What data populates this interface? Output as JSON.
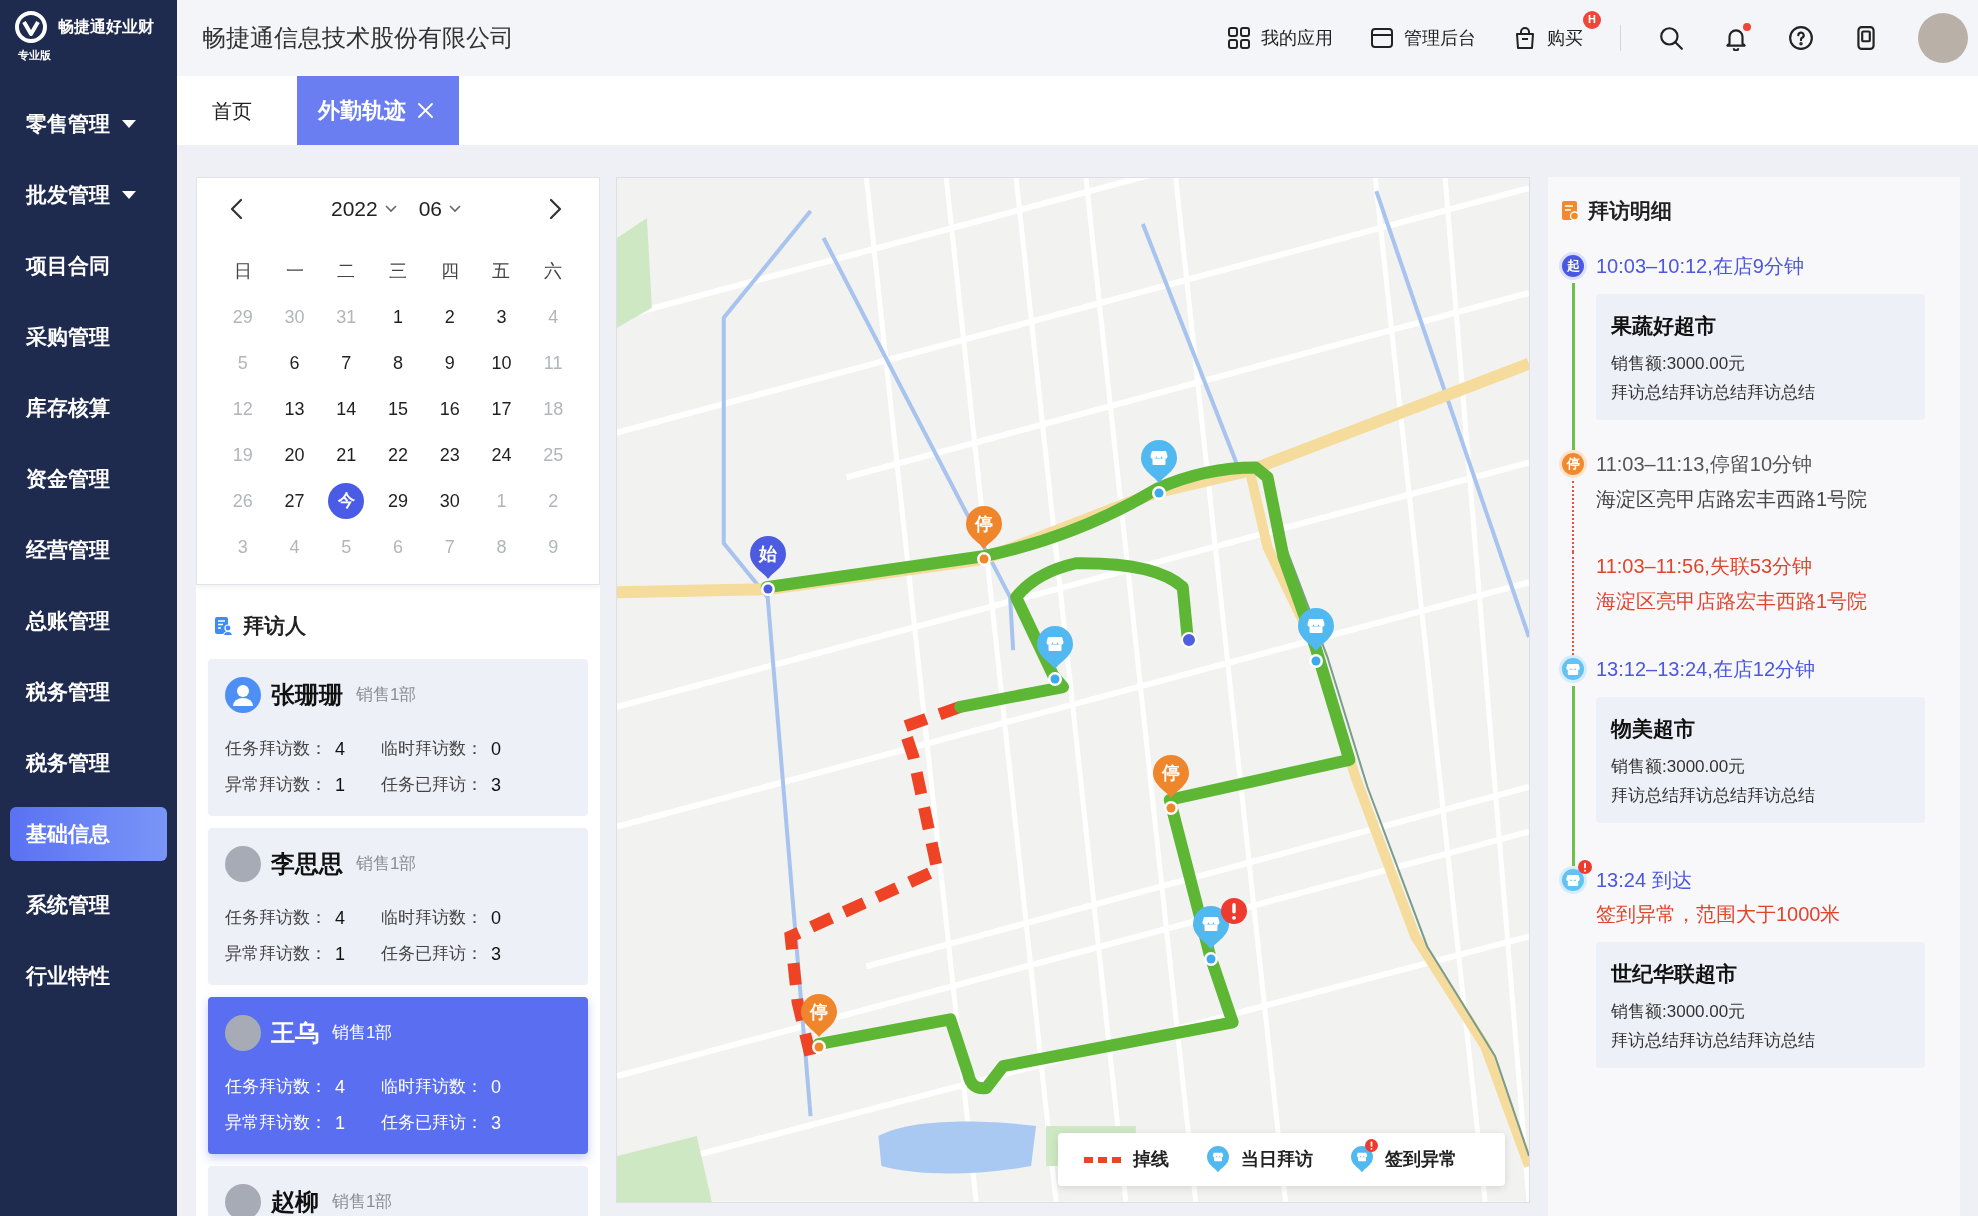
{
  "sidebar": {
    "logo": {
      "name": "畅捷通好业财",
      "edition": "专业版"
    },
    "items": [
      {
        "label": "零售管理",
        "has_submenu": true,
        "selected": false
      },
      {
        "label": "批发管理",
        "has_submenu": true,
        "selected": false
      },
      {
        "label": "项目合同",
        "has_submenu": false,
        "selected": false
      },
      {
        "label": "采购管理",
        "has_submenu": false,
        "selected": false
      },
      {
        "label": "库存核算",
        "has_submenu": false,
        "selected": false
      },
      {
        "label": "资金管理",
        "has_submenu": false,
        "selected": false
      },
      {
        "label": "经营管理",
        "has_submenu": false,
        "selected": false
      },
      {
        "label": "总账管理",
        "has_submenu": false,
        "selected": false
      },
      {
        "label": "税务管理",
        "has_submenu": false,
        "selected": false
      },
      {
        "label": "税务管理",
        "has_submenu": false,
        "selected": false
      },
      {
        "label": "基础信息",
        "has_submenu": false,
        "selected": true
      },
      {
        "label": "系统管理",
        "has_submenu": false,
        "selected": false
      },
      {
        "label": "行业特性",
        "has_submenu": false,
        "selected": false
      }
    ]
  },
  "top_bar": {
    "company": "畅捷通信息技术股份有限公司",
    "links": [
      {
        "kind": "apps",
        "label": "我的应用"
      },
      {
        "kind": "admin",
        "label": "管理后台"
      },
      {
        "kind": "buy",
        "label": "购买",
        "badge": "H"
      }
    ],
    "icons": [
      {
        "kind": "search"
      },
      {
        "kind": "bell",
        "unread": true
      },
      {
        "kind": "help"
      },
      {
        "kind": "device"
      },
      {
        "kind": "avatar"
      }
    ]
  },
  "tabs": [
    {
      "label": "首页",
      "selected": false,
      "closable": false
    },
    {
      "label": "外勤轨迹",
      "selected": true,
      "closable": true
    }
  ],
  "calendar": {
    "year": "2022",
    "month": "06",
    "weekdays": [
      "日",
      "一",
      "二",
      "三",
      "四",
      "五",
      "六"
    ],
    "days": [
      {
        "text": "29",
        "muted": true,
        "selected": false
      },
      {
        "text": "30",
        "muted": true,
        "selected": false
      },
      {
        "text": "31",
        "muted": true,
        "selected": false
      },
      {
        "text": "1",
        "muted": false,
        "selected": false
      },
      {
        "text": "2",
        "muted": false,
        "selected": false
      },
      {
        "text": "3",
        "muted": false,
        "selected": false
      },
      {
        "text": "4",
        "muted": true,
        "selected": false
      },
      {
        "text": "5",
        "muted": true,
        "selected": false
      },
      {
        "text": "6",
        "muted": false,
        "selected": false
      },
      {
        "text": "7",
        "muted": false,
        "selected": false
      },
      {
        "text": "8",
        "muted": false,
        "selected": false
      },
      {
        "text": "9",
        "muted": false,
        "selected": false
      },
      {
        "text": "10",
        "muted": false,
        "selected": false
      },
      {
        "text": "11",
        "muted": true,
        "selected": false
      },
      {
        "text": "12",
        "muted": true,
        "selected": false
      },
      {
        "text": "13",
        "muted": false,
        "selected": false
      },
      {
        "text": "14",
        "muted": false,
        "selected": false
      },
      {
        "text": "15",
        "muted": false,
        "selected": false
      },
      {
        "text": "16",
        "muted": false,
        "selected": false
      },
      {
        "text": "17",
        "muted": false,
        "selected": false
      },
      {
        "text": "18",
        "muted": true,
        "selected": false
      },
      {
        "text": "19",
        "muted": true,
        "selected": false
      },
      {
        "text": "20",
        "muted": false,
        "selected": false
      },
      {
        "text": "21",
        "muted": false,
        "selected": false
      },
      {
        "text": "22",
        "muted": false,
        "selected": false
      },
      {
        "text": "23",
        "muted": false,
        "selected": false
      },
      {
        "text": "24",
        "muted": false,
        "selected": false
      },
      {
        "text": "25",
        "muted": true,
        "selected": false
      },
      {
        "text": "26",
        "muted": true,
        "selected": false
      },
      {
        "text": "27",
        "muted": false,
        "selected": false
      },
      {
        "text": "今",
        "muted": false,
        "selected": true
      },
      {
        "text": "29",
        "muted": false,
        "selected": false
      },
      {
        "text": "30",
        "muted": false,
        "selected": false
      },
      {
        "text": "1",
        "muted": true,
        "selected": false
      },
      {
        "text": "2",
        "muted": true,
        "selected": false
      },
      {
        "text": "3",
        "muted": true,
        "selected": false
      },
      {
        "text": "4",
        "muted": true,
        "selected": false
      },
      {
        "text": "5",
        "muted": true,
        "selected": false
      },
      {
        "text": "6",
        "muted": true,
        "selected": false
      },
      {
        "text": "7",
        "muted": true,
        "selected": false
      },
      {
        "text": "8",
        "muted": true,
        "selected": false
      },
      {
        "text": "9",
        "muted": true,
        "selected": false
      }
    ]
  },
  "visitors": {
    "title": "拜访人",
    "people": [
      {
        "kind": "placeholder",
        "name": "张珊珊",
        "dept": "销售1部",
        "selected": false,
        "stats": [
          {
            "label": "任务拜访数：",
            "value": "4"
          },
          {
            "label": "临时拜访数：",
            "value": "0"
          },
          {
            "label": "异常拜访数：",
            "value": "1"
          },
          {
            "label": "任务已拜访：",
            "value": "3"
          }
        ]
      },
      {
        "kind": "photo",
        "name": "李思思",
        "dept": "销售1部",
        "selected": false,
        "stats": [
          {
            "label": "任务拜访数：",
            "value": "4"
          },
          {
            "label": "临时拜访数：",
            "value": "0"
          },
          {
            "label": "异常拜访数：",
            "value": "1"
          },
          {
            "label": "任务已拜访：",
            "value": "3"
          }
        ]
      },
      {
        "kind": "photo",
        "name": "王乌",
        "dept": "销售1部",
        "selected": true,
        "stats": [
          {
            "label": "任务拜访数：",
            "value": "4"
          },
          {
            "label": "临时拜访数：",
            "value": "0"
          },
          {
            "label": "异常拜访数：",
            "value": "1"
          },
          {
            "label": "任务已拜访：",
            "value": "3"
          }
        ]
      },
      {
        "kind": "photo",
        "name": "赵柳",
        "dept": "销售1部",
        "selected": false
      }
    ]
  },
  "map": {
    "markers": [
      {
        "kind": "start",
        "label": "始"
      },
      {
        "kind": "stop",
        "label": "停"
      },
      {
        "kind": "shop"
      },
      {
        "kind": "shop"
      },
      {
        "kind": "end"
      },
      {
        "kind": "shop"
      },
      {
        "kind": "stop",
        "label": "停"
      },
      {
        "kind": "shop_alert"
      },
      {
        "kind": "stop",
        "label": "停"
      }
    ],
    "legend": [
      {
        "kind": "offline",
        "label": "掉线"
      },
      {
        "kind": "visit",
        "label": "当日拜访"
      },
      {
        "kind": "alert",
        "label": "签到异常"
      }
    ]
  },
  "details": {
    "title": "拜访明细",
    "entries": [
      {
        "kind": "start",
        "badge": "起",
        "time": "10:03–10:12,在店9分钟",
        "store": "果蔬好超市",
        "sales": "销售额:3000.00元",
        "summary": "拜访总结拜访总结拜访总结"
      },
      {
        "kind": "stop",
        "badge": "停",
        "time": "11:03–11:13,停留10分钟",
        "address": "海淀区亮甲店路宏丰西路1号院"
      },
      {
        "kind": "offline",
        "time": "11:03–11:56,失联53分钟",
        "address": "海淀区亮甲店路宏丰西路1号院"
      },
      {
        "kind": "shop",
        "time": "13:12–13:24,在店12分钟",
        "store": "物美超市",
        "sales": "销售额:3000.00元",
        "summary": "拜访总结拜访总结拜访总结"
      },
      {
        "kind": "alert",
        "time": "13:24 到达",
        "warning": "签到异常，范围大于1000米",
        "store": "世纪华联超市",
        "sales": "销售额:3000.00元",
        "summary": "拜访总结拜访总结拜访总结"
      }
    ]
  }
}
